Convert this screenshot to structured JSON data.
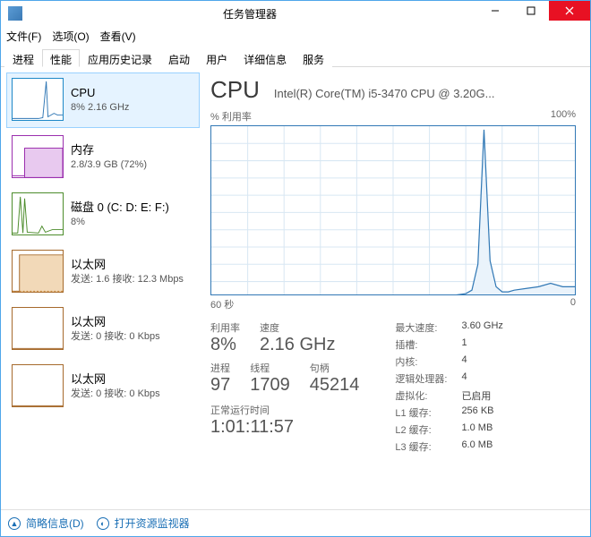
{
  "window": {
    "title": "任务管理器"
  },
  "menu": {
    "file": "文件(F)",
    "options": "选项(O)",
    "view": "查看(V)"
  },
  "tabs": [
    "进程",
    "性能",
    "应用历史记录",
    "启动",
    "用户",
    "详细信息",
    "服务"
  ],
  "active_tab": 1,
  "sidebar": {
    "items": [
      {
        "name": "CPU",
        "stat": "8%  2.16 GHz",
        "kind": "cpu"
      },
      {
        "name": "内存",
        "stat": "2.8/3.9 GB (72%)",
        "kind": "mem"
      },
      {
        "name": "磁盘 0 (C: D: E: F:)",
        "stat": "8%",
        "kind": "disk"
      },
      {
        "name": "以太网",
        "stat": "发送: 1.6  接收: 12.3 Mbps",
        "kind": "net"
      },
      {
        "name": "以太网",
        "stat": "发送: 0  接收: 0 Kbps",
        "kind": "net2"
      },
      {
        "name": "以太网",
        "stat": "发送: 0  接收: 0 Kbps",
        "kind": "net3"
      }
    ],
    "selected": 0
  },
  "detail": {
    "title": "CPU",
    "subtitle": "Intel(R) Core(TM) i5-3470 CPU @ 3.20G...",
    "y_label": "% 利用率",
    "y_max": "100%",
    "x_left": "60 秒",
    "x_right": "0",
    "stats": {
      "util_label": "利用率",
      "util_value": "8%",
      "speed_label": "速度",
      "speed_value": "2.16 GHz",
      "proc_label": "进程",
      "proc_value": "97",
      "thread_label": "线程",
      "thread_value": "1709",
      "handle_label": "句柄",
      "handle_value": "45214",
      "uptime_label": "正常运行时间",
      "uptime_value": "1:01:11:57"
    },
    "right": {
      "maxspeed_l": "最大速度:",
      "maxspeed_v": "3.60 GHz",
      "sockets_l": "插槽:",
      "sockets_v": "1",
      "cores_l": "内核:",
      "cores_v": "4",
      "logical_l": "逻辑处理器:",
      "logical_v": "4",
      "virt_l": "虚拟化:",
      "virt_v": "已启用",
      "l1_l": "L1 缓存:",
      "l1_v": "256 KB",
      "l2_l": "L2 缓存:",
      "l2_v": "1.0 MB",
      "l3_l": "L3 缓存:",
      "l3_v": "6.0 MB"
    }
  },
  "footer": {
    "less": "简略信息(D)",
    "resmon": "打开资源监视器"
  },
  "chart_data": {
    "type": "line",
    "title": "% 利用率",
    "xlabel": "60 秒",
    "ylabel": "% 利用率",
    "ylim": [
      0,
      100
    ],
    "x_seconds_ago": [
      60,
      55,
      50,
      45,
      40,
      35,
      30,
      25,
      20,
      18,
      17,
      16,
      15,
      14,
      13,
      12,
      11,
      10,
      8,
      6,
      4,
      2,
      0
    ],
    "values": [
      2,
      2,
      2,
      2,
      2,
      2,
      2,
      2,
      2,
      3,
      5,
      20,
      98,
      22,
      7,
      4,
      4,
      5,
      6,
      7,
      9,
      7,
      7
    ]
  },
  "colors": {
    "cpu": "#3178b5",
    "mem": "#9b2fae",
    "disk": "#4c8c2b",
    "net": "#a66a2c"
  }
}
